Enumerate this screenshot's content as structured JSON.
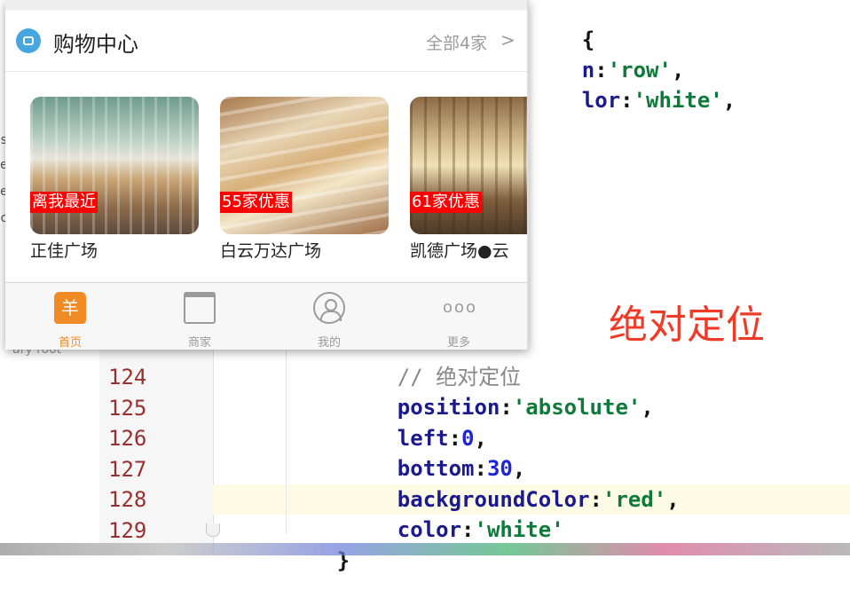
{
  "editor": {
    "top_fragments": [
      {
        "text": "{",
        "kind": "punct"
      },
      {
        "text": "n:'row',",
        "kind": "mixed"
      },
      {
        "text": "lor:'white',",
        "kind": "mixed"
      }
    ],
    "side_fragments": [
      "s",
      "e",
      "e",
      "c"
    ],
    "library_fragment": "ary root",
    "comment_fragment": "// 绝对定位",
    "lines": [
      {
        "num": "124",
        "key": "position",
        "value": "'absolute'",
        "tail": ","
      },
      {
        "num": "125",
        "key": "left",
        "value": "0",
        "tail": ","
      },
      {
        "num": "126",
        "key": "bottom",
        "value": "30",
        "tail": ","
      },
      {
        "num": "127",
        "key": "backgroundColor",
        "value": "'red'",
        "tail": ","
      },
      {
        "num": "128",
        "key": "color",
        "value": "'white'",
        "tail": ""
      },
      {
        "num": "129",
        "key": "",
        "value": "}",
        "tail": ""
      }
    ]
  },
  "annotation": "绝对定位",
  "simulator": {
    "section_title": "购物中心",
    "all_link": "全部4家",
    "all_chevron": ">",
    "malls": [
      {
        "name": "正佳广场",
        "badge": "离我最近"
      },
      {
        "name": "白云万达广场",
        "badge": "55家优惠"
      },
      {
        "name": "凯德广场●云",
        "badge": "61家优惠"
      }
    ],
    "tabs": [
      {
        "label": "首页",
        "icon": "home-icon",
        "glyph": "羊",
        "active": true
      },
      {
        "label": "商家",
        "icon": "shop-icon",
        "glyph": "",
        "active": false
      },
      {
        "label": "我的",
        "icon": "profile-icon",
        "glyph": "",
        "active": false
      },
      {
        "label": "更多",
        "icon": "more-icon",
        "glyph": "ooo",
        "active": false
      }
    ]
  },
  "colors": {
    "accent_orange": "#f08a24",
    "badge_red": "#ff0000",
    "annotation_red": "#ee3a26",
    "code_key": "#1a1a8c",
    "code_string": "#0d7a3a",
    "code_number": "#1c25d8",
    "line_number": "#9a2f2f"
  }
}
